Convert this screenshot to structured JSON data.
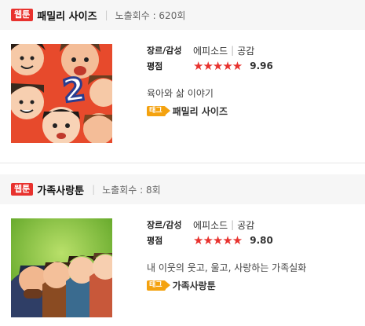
{
  "badge_label": "웹툰",
  "items": [
    {
      "title": "패밀리 사이즈",
      "count_text": "노출회수 : 620회",
      "genre_label": "장르/감성",
      "genre_value": "에피소드",
      "mood_value": "공감",
      "rating_label": "평점",
      "stars": "★★★★★",
      "rating_value": "9.96",
      "description": "육아와 삶 이야기",
      "tag_badge": "태그",
      "tag_text": "패밀리 사이즈",
      "thumbnail_number": "2"
    },
    {
      "title": "가족사랑툰",
      "count_text": "노출회수 : 8회",
      "genre_label": "장르/감성",
      "genre_value": "에피소드",
      "mood_value": "공감",
      "rating_label": "평점",
      "stars": "★★★★★",
      "rating_value": "9.80",
      "description": "내 이웃의 웃고, 울고, 사랑하는 가족실화",
      "tag_badge": "태그",
      "tag_text": "가족사랑툰"
    }
  ],
  "colors": {
    "badge": "#e8322e",
    "star": "#e8322e",
    "tag": "#f4a20f",
    "header_bg": "#f6f6f6"
  }
}
